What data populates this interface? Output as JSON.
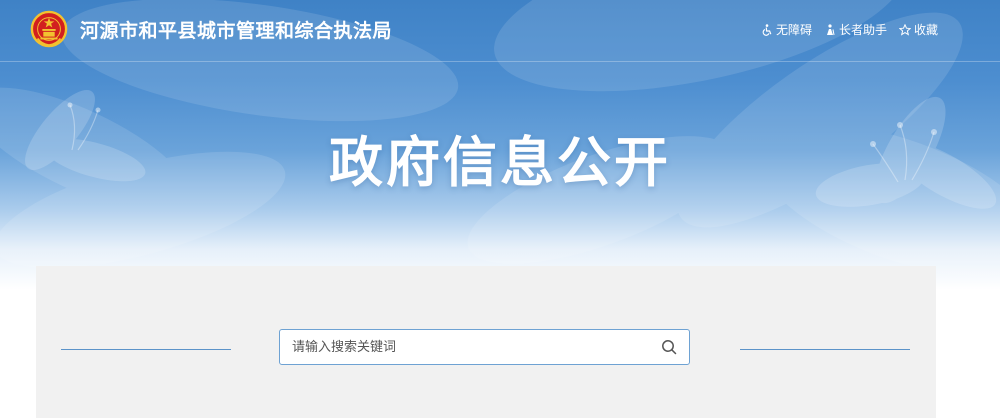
{
  "header": {
    "site_title": "河源市和平县城市管理和综合执法局",
    "emblem_icon": "national-emblem-icon",
    "links": {
      "accessibility": {
        "label": "无障碍",
        "icon": "wheelchair-icon"
      },
      "elderly": {
        "label": "长者助手",
        "icon": "elderly-helper-icon"
      },
      "favorite": {
        "label": "收藏",
        "icon": "star-icon"
      }
    }
  },
  "hero": {
    "heading": "政府信息公开"
  },
  "search": {
    "placeholder": "请输入搜索关键词",
    "icon": "search-icon"
  },
  "colors": {
    "banner_blue": "#4d8ed0",
    "accent_line": "#5b93c9",
    "panel_bg": "#f1f1f1",
    "emblem_red": "#d21f1f",
    "emblem_gold": "#f2c230"
  }
}
